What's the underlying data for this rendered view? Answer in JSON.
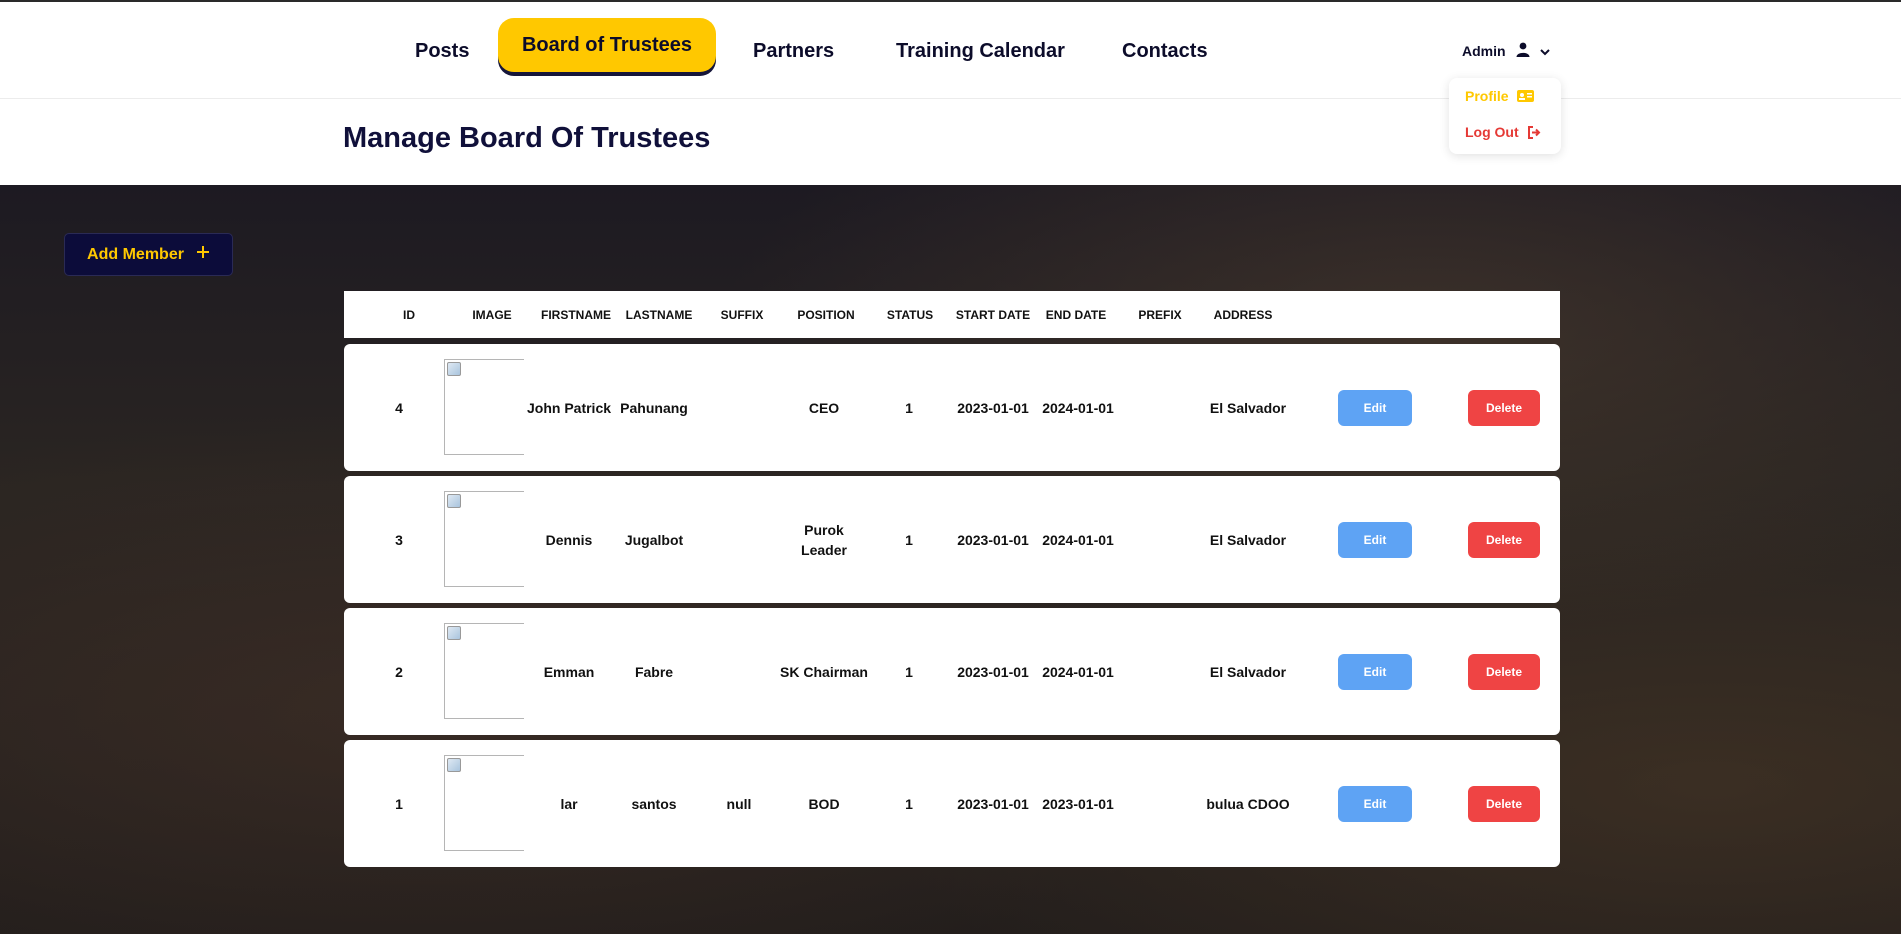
{
  "nav": {
    "items": [
      "Posts",
      "Board of Trustees",
      "Partners",
      "Training Calendar",
      "Contacts"
    ],
    "active": "Board of Trustees",
    "user_label": "Admin"
  },
  "dropdown": {
    "profile": "Profile",
    "logout": "Log Out"
  },
  "page": {
    "title": "Manage Board Of Trustees",
    "add_button": "Add Member"
  },
  "table": {
    "headers": [
      "ID",
      "IMAGE",
      "FIRSTNAME",
      "LASTNAME",
      "SUFFIX",
      "POSITION",
      "STATUS",
      "START DATE",
      "END DATE",
      "PREFIX",
      "ADDRESS"
    ],
    "rows": [
      {
        "id": "4",
        "firstname": "John Patrick",
        "lastname": "Pahunang",
        "suffix": "",
        "position": "CEO",
        "status": "1",
        "start": "2023-01-01",
        "end": "2024-01-01",
        "prefix": "",
        "address": "El Salvador"
      },
      {
        "id": "3",
        "firstname": "Dennis",
        "lastname": "Jugalbot",
        "suffix": "",
        "position": "Purok Leader",
        "status": "1",
        "start": "2023-01-01",
        "end": "2024-01-01",
        "prefix": "",
        "address": "El Salvador"
      },
      {
        "id": "2",
        "firstname": "Emman",
        "lastname": "Fabre",
        "suffix": "",
        "position": "SK Chairman",
        "status": "1",
        "start": "2023-01-01",
        "end": "2024-01-01",
        "prefix": "",
        "address": "El Salvador"
      },
      {
        "id": "1",
        "firstname": "lar",
        "lastname": "santos",
        "suffix": "null",
        "position": "BOD",
        "status": "1",
        "start": "2023-01-01",
        "end": "2023-01-01",
        "prefix": "",
        "address": "bulua CDOO"
      }
    ],
    "edit_label": "Edit",
    "delete_label": "Delete"
  },
  "colors": {
    "accent": "#ffc800",
    "navy": "#0c0c3a",
    "edit": "#5ea3f4",
    "delete": "#ef4444"
  }
}
